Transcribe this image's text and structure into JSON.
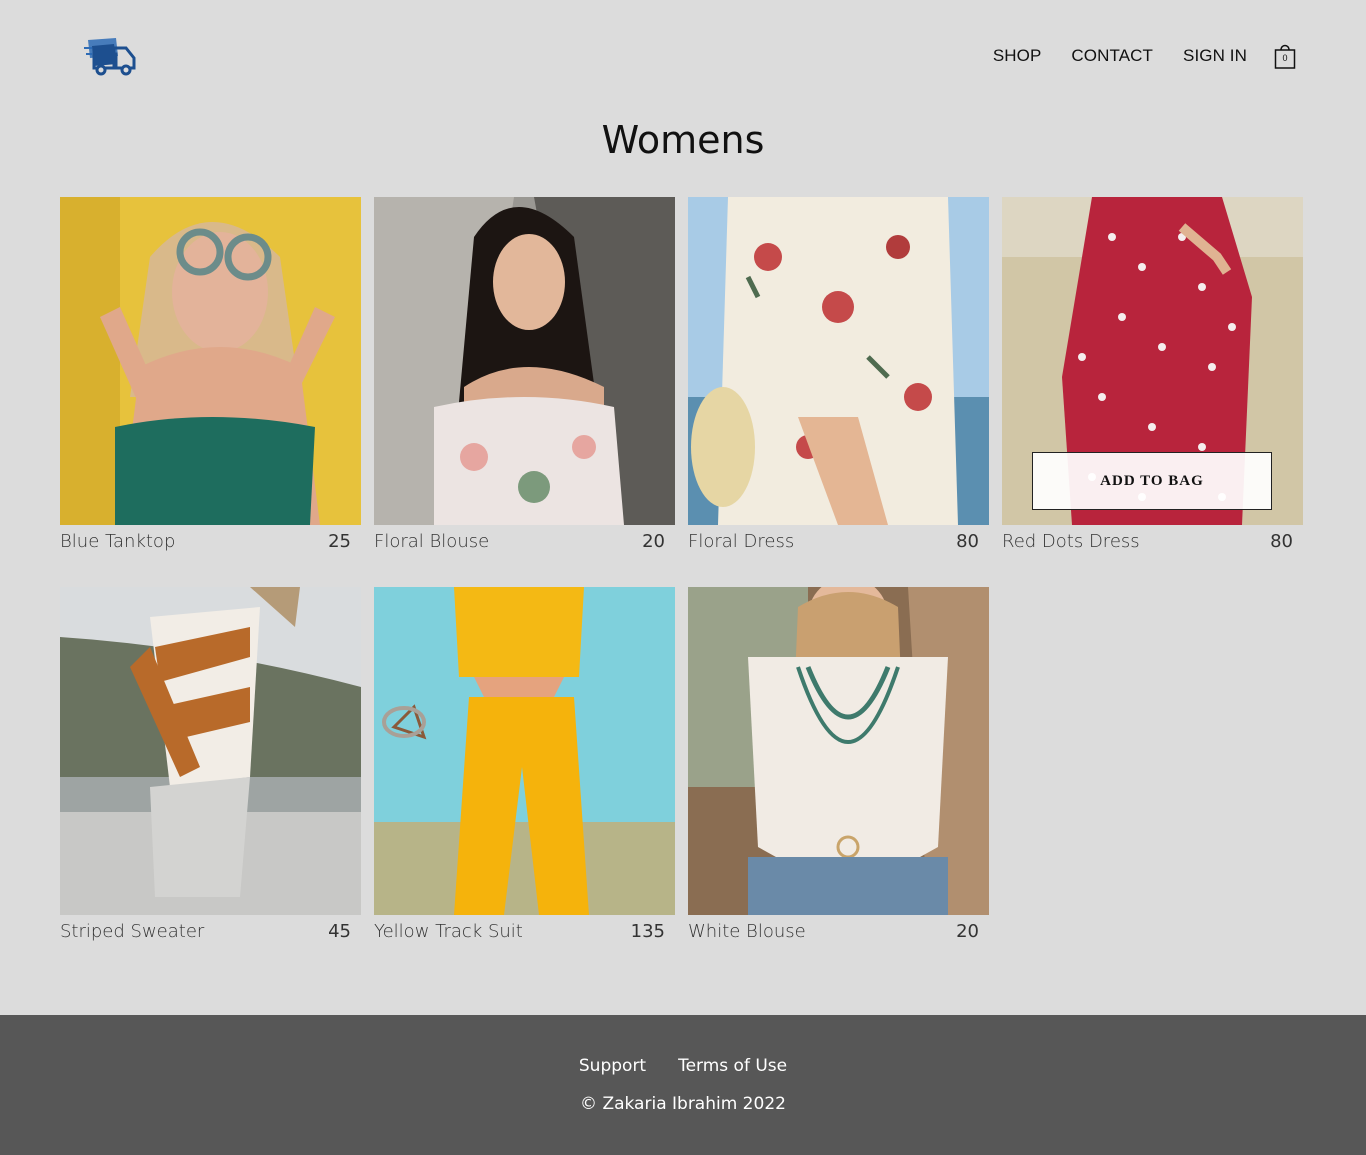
{
  "header": {
    "logo_icon": "delivery-truck-icon",
    "nav": [
      {
        "label": "SHOP"
      },
      {
        "label": "CONTACT"
      },
      {
        "label": "SIGN IN"
      }
    ],
    "bag": {
      "icon": "shopping-bag-icon",
      "count": "0"
    }
  },
  "page": {
    "title": "Womens"
  },
  "products": [
    {
      "name": "Blue Tanktop",
      "price": "25"
    },
    {
      "name": "Floral Blouse",
      "price": "20"
    },
    {
      "name": "Floral Dress",
      "price": "80"
    },
    {
      "name": "Red Dots Dress",
      "price": "80",
      "button": "ADD TO BAG"
    },
    {
      "name": "Striped Sweater",
      "price": "45"
    },
    {
      "name": "Yellow Track Suit",
      "price": "135"
    },
    {
      "name": "White Blouse",
      "price": "20"
    }
  ],
  "footer": {
    "links": [
      {
        "label": "Support"
      },
      {
        "label": "Terms of Use"
      }
    ],
    "copyright": "© Zakaria Ibrahim 2022"
  },
  "colors": {
    "background": "#dcdcdc",
    "footer": "#575757",
    "logo": "#2f6fb8"
  }
}
